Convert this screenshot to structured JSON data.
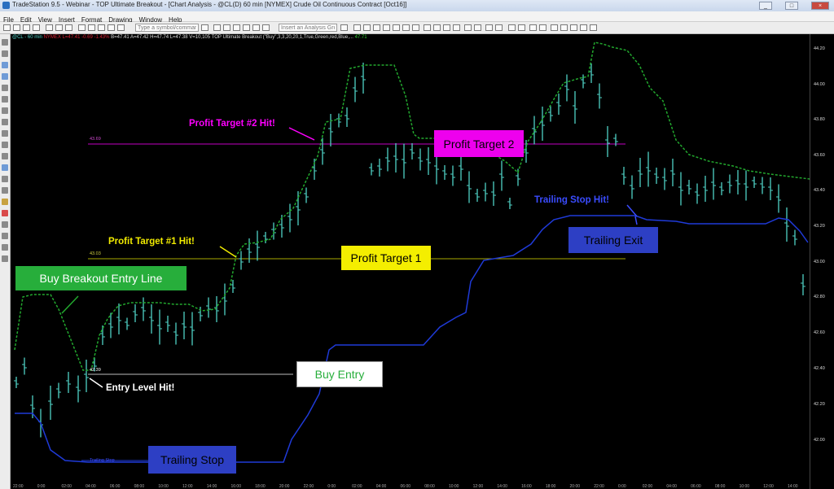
{
  "window": {
    "title": "TradeStation 9.5 - Webinar - TOP Ultimate Breakout - [Chart Analysis - @CL(D) 60 min [NYMEX] Crude Oil Continuous Contract [Oct16]]",
    "buttons": [
      "_",
      "□",
      "×"
    ]
  },
  "menu": [
    "File",
    "Edit",
    "View",
    "Insert",
    "Format",
    "Drawing",
    "Window",
    "Help"
  ],
  "toolbar": {
    "symbol_placeholder": "Type a symbol/command",
    "group_placeholder": "Insert an Analysis Group"
  },
  "status_line": {
    "symbol": "@CL - 60 min",
    "exchange": "NYMEX",
    "change": "L=47.41 -0.69 -1.43%",
    "values": "B=47.41 A=47.42 H=47.74 L=47.38 V=10,105",
    "indicator": "TOP Ultimate Breakout (\"Buy\",3,3,20,20,1,True,Green,red,Blue,...",
    "tail": "47.71"
  },
  "price_axis": [
    "44.20",
    "44.00",
    "43.80",
    "43.60",
    "43.40",
    "43.20",
    "43.00",
    "42.80",
    "42.60",
    "42.40",
    "42.20",
    "42.00"
  ],
  "time_axis": [
    "22:00",
    "0:00",
    "02:00",
    "04:00",
    "06:00",
    "08:00",
    "10:00",
    "12:00",
    "14:00",
    "16:00",
    "18:00",
    "20:00",
    "22:00",
    "0:00",
    "02:00",
    "04:00",
    "06:00",
    "08:00",
    "10:00",
    "12:00",
    "14:00",
    "16:00",
    "18:00",
    "20:00",
    "22:00",
    "0:00",
    "02:00",
    "04:00",
    "06:00",
    "08:00",
    "10:00",
    "12:00",
    "14:00"
  ],
  "levels": {
    "profit_target_2": "43.69",
    "profit_target_1": "43.03",
    "entry": "42.39",
    "trailing_stop": "Trailing Stop"
  },
  "callouts": {
    "buy_breakout_entry_line": "Buy Breakout Entry Line",
    "profit_target_1": "Profit Target 1",
    "profit_target_2": "Profit Target 2",
    "buy_entry": "Buy Entry",
    "trailing_stop": "Trailing Stop",
    "trailing_exit": "Trailing Exit"
  },
  "annotations": {
    "profit_target_2_hit": "Profit Target #2 Hit!",
    "profit_target_1_hit": "Profit Target #1 Hit!",
    "entry_level_hit": "Entry Level Hit!",
    "trailing_stop_hit": "Trailing Stop Hit!"
  },
  "colors": {
    "bars": "#4fd1c5",
    "entry_line": "#22a82e",
    "trailing_stop": "#1f3ad8",
    "pt1": "#c8c800",
    "pt2": "#c400c4",
    "callout_green": "#27ae3b",
    "callout_yellow": "#f4ee00",
    "callout_magenta": "#ee00ee",
    "callout_blue": "#2d3fc4"
  }
}
